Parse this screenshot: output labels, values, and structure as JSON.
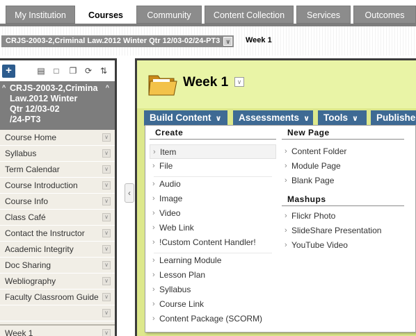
{
  "tabs": [
    {
      "label": "My Institution",
      "active": false
    },
    {
      "label": "Courses",
      "active": true
    },
    {
      "label": "Community",
      "active": false
    },
    {
      "label": "Content Collection",
      "active": false
    },
    {
      "label": "Services",
      "active": false
    },
    {
      "label": "Outcomes",
      "active": false
    }
  ],
  "breadcrumb": {
    "course": "CRJS-2003-2,Criminal Law.2012 Winter Qtr 12/03-02/24-PT3",
    "current": "Week 1"
  },
  "sidebar": {
    "add_label": "+",
    "title_lines": [
      "CRJS-2003-2,Crimina",
      "Law.2012 Winter",
      "Qtr 12/03-02",
      "/24-PT3"
    ],
    "items": [
      "Course Home",
      "Syllabus",
      "Term Calendar",
      "Course Introduction",
      "Course Info",
      "Class Café",
      "Contact the Instructor",
      "Academic Integrity",
      "Doc Sharing",
      "Webliography",
      "Faculty Classroom Guide"
    ],
    "week_item": "Week 1"
  },
  "main": {
    "title": "Week 1",
    "actions": [
      "Build Content",
      "Assessments",
      "Tools",
      "Publisher"
    ]
  },
  "dropdown": {
    "create": {
      "heading": "Create",
      "group1": [
        "Item",
        "File"
      ],
      "group2": [
        "Audio",
        "Image",
        "Video",
        "Web Link",
        "!Custom Content Handler!"
      ],
      "group3": [
        "Learning Module",
        "Lesson Plan",
        "Syllabus",
        "Course Link",
        "Content Package (SCORM)"
      ]
    },
    "new_page": {
      "heading": "New Page",
      "items": [
        "Content Folder",
        "Module Page",
        "Blank Page"
      ]
    },
    "mashups": {
      "heading": "Mashups",
      "items": [
        "Flickr Photo",
        "SlideShare Presentation",
        "YouTube Video"
      ]
    }
  },
  "icons": {
    "collapse": "chevron-left-icon",
    "folder": "folder-icon",
    "dropdown": "chevron-down-icon"
  },
  "colors": {
    "tab_bg": "#8c8c8c",
    "action_btn": "#3e6a94",
    "main_bg": "#e9f4a6",
    "sidebar_bg": "#f1eee6"
  }
}
